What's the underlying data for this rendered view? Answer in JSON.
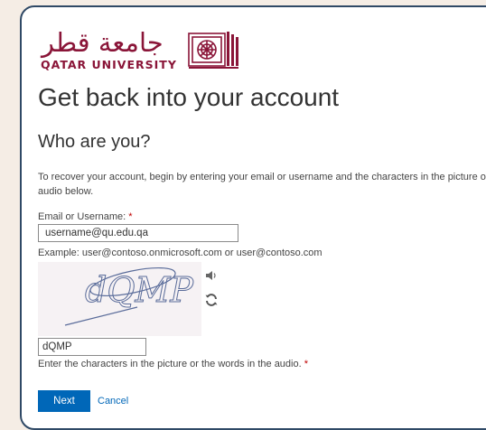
{
  "logo": {
    "arabic": "جامعة قطر",
    "english": "QATAR UNIVERSITY"
  },
  "page": {
    "title": "Get back into your account",
    "subtitle": "Who are you?",
    "description": "To recover your account, begin by entering your email or username and the characters in the picture or audio below."
  },
  "form": {
    "email_label": "Email or Username:",
    "required_mark": "*",
    "email_value": "username@qu.edu.qa",
    "email_example": "Example: user@contoso.onmicrosoft.com or user@contoso.com",
    "captcha_image_text": "dQMP",
    "captcha_value": "dQMP",
    "captcha_hint": "Enter the characters in the picture or the words in the audio.",
    "captcha_required_mark": "*"
  },
  "actions": {
    "next_label": "Next",
    "cancel_label": "Cancel"
  },
  "icons": {
    "audio": "speaker-icon",
    "refresh": "refresh-icon"
  },
  "colors": {
    "brand": "#8a1538",
    "primary": "#0067b8",
    "frame": "#2f4966",
    "background": "#f5ede5",
    "required": "#c00000"
  }
}
